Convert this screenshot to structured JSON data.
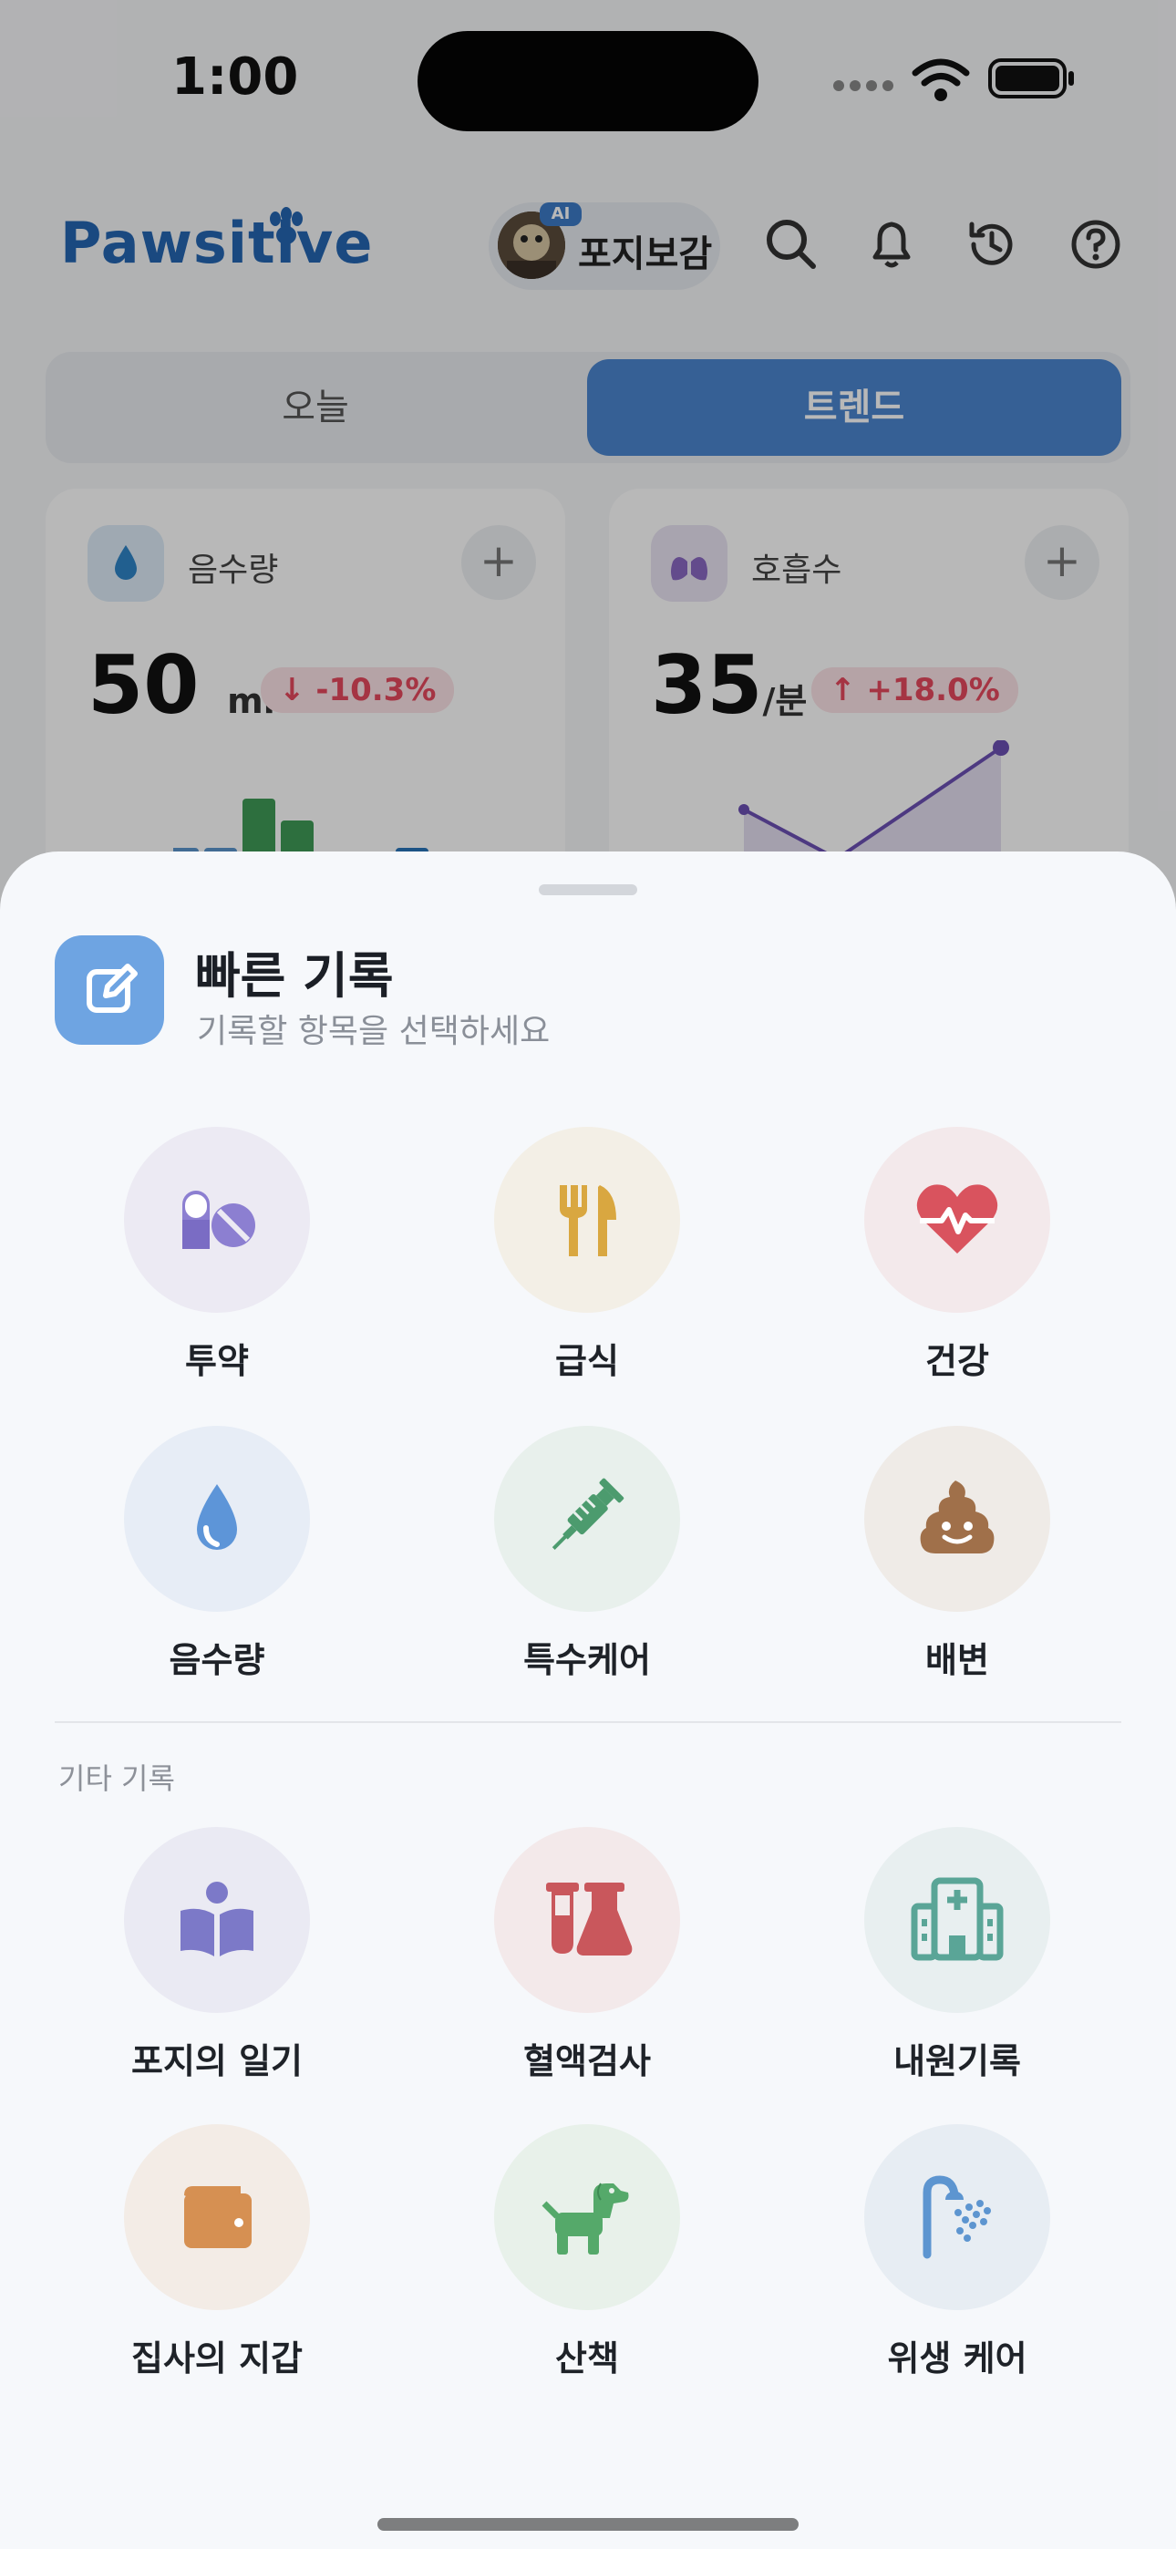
{
  "status_bar": {
    "time": "1:00"
  },
  "header": {
    "logo": "Pawsitive",
    "profile": {
      "badge": "AI",
      "name": "포지보감"
    },
    "icons": [
      "search-icon",
      "bell-icon",
      "history-icon",
      "help-icon"
    ]
  },
  "tabs": {
    "today": "오늘",
    "trend": "트렌드",
    "selected": "트렌드"
  },
  "cards": [
    {
      "title": "음수량",
      "value": "50",
      "unit": "ml",
      "delta": "-10.3%",
      "delta_direction": "down",
      "bars": [
        {
          "value": 0.55,
          "color": "#5b95cc"
        },
        {
          "value": 0.55,
          "color": "#5b95cc"
        },
        {
          "value": 1.0,
          "color": "#3f9a57"
        },
        {
          "value": 0.8,
          "color": "#3f9a57"
        },
        {
          "value": 0.35,
          "color": "#5b95cc"
        },
        {
          "value": 0.35,
          "color": "#5b95cc"
        },
        {
          "value": 0.55,
          "color": "#2873b9"
        }
      ]
    },
    {
      "title": "호흡수",
      "value": "35",
      "unit": "/분",
      "delta": "+18.0%",
      "delta_direction": "up"
    }
  ],
  "sheet": {
    "title": "빠른 기록",
    "subtitle": "기록할 항목을 선택하세요",
    "primary_items": [
      {
        "label": "투약",
        "icon": "pills-icon",
        "bg": "#eceaf3"
      },
      {
        "label": "급식",
        "icon": "fork-knife-icon",
        "bg": "#f3efe6"
      },
      {
        "label": "건강",
        "icon": "heart-pulse-icon",
        "bg": "#f3e9eb"
      },
      {
        "label": "음수량",
        "icon": "water-drop-icon",
        "bg": "#e7edf6"
      },
      {
        "label": "특수케어",
        "icon": "syringe-icon",
        "bg": "#e8f0ec"
      },
      {
        "label": "배변",
        "icon": "poop-icon",
        "bg": "#efebe7"
      }
    ],
    "section_label": "기타 기록",
    "other_items": [
      {
        "label": "포지의 일기",
        "icon": "reading-person-icon",
        "bg": "#eaeaf3"
      },
      {
        "label": "혈액검사",
        "icon": "flask-icon",
        "bg": "#f3e9ea"
      },
      {
        "label": "내원기록",
        "icon": "hospital-icon",
        "bg": "#e8eff0"
      },
      {
        "label": "집사의 지갑",
        "icon": "wallet-icon",
        "bg": "#f3ece6"
      },
      {
        "label": "산책",
        "icon": "dog-icon",
        "bg": "#e8f1ea"
      },
      {
        "label": "위생 케어",
        "icon": "shower-icon",
        "bg": "#e7edf3"
      }
    ]
  }
}
